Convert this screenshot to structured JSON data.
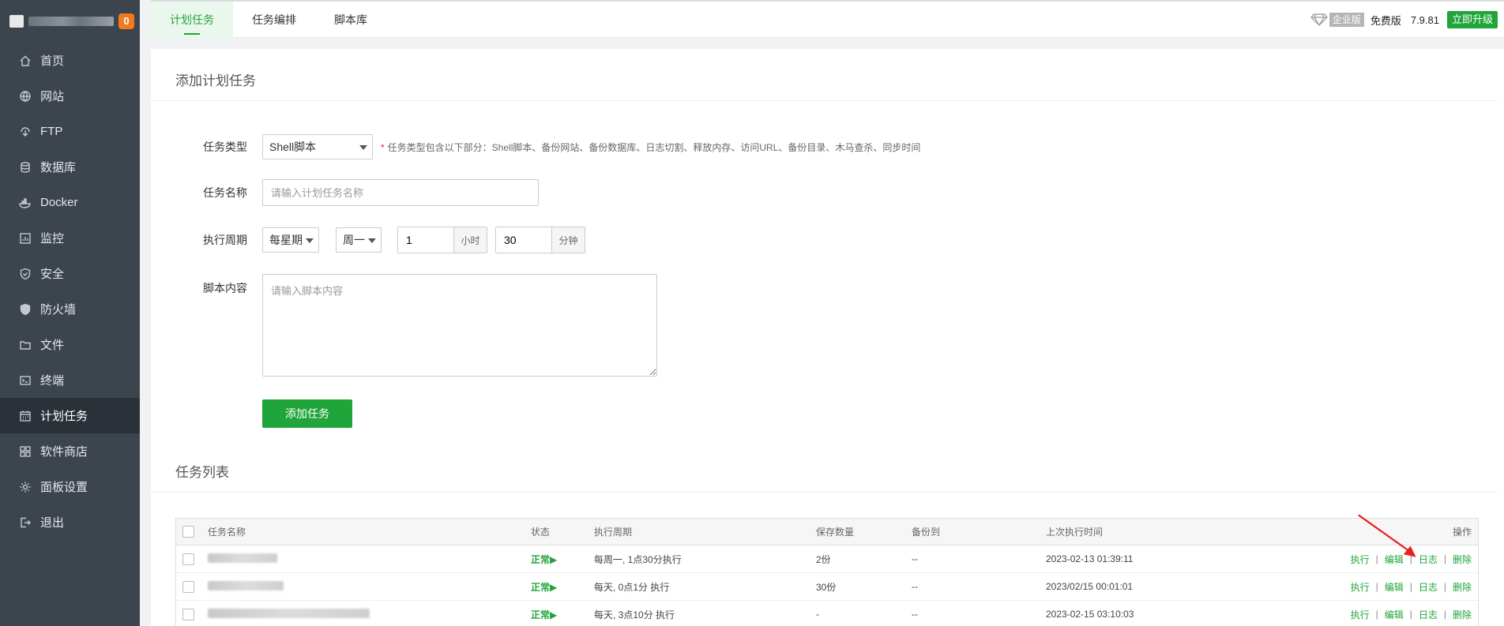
{
  "sidebar": {
    "badge": "0",
    "items": [
      {
        "label": "首页",
        "icon": "home-icon"
      },
      {
        "label": "网站",
        "icon": "globe-icon"
      },
      {
        "label": "FTP",
        "icon": "ftp-icon"
      },
      {
        "label": "数据库",
        "icon": "database-icon"
      },
      {
        "label": "Docker",
        "icon": "docker-icon"
      },
      {
        "label": "监控",
        "icon": "monitor-icon"
      },
      {
        "label": "安全",
        "icon": "shield-icon"
      },
      {
        "label": "防火墙",
        "icon": "firewall-icon"
      },
      {
        "label": "文件",
        "icon": "folder-icon"
      },
      {
        "label": "终端",
        "icon": "terminal-icon"
      },
      {
        "label": "计划任务",
        "icon": "calendar-icon",
        "active": true
      },
      {
        "label": "软件商店",
        "icon": "apps-icon"
      },
      {
        "label": "面板设置",
        "icon": "settings-icon"
      },
      {
        "label": "退出",
        "icon": "logout-icon"
      }
    ]
  },
  "topnav": {
    "tabs": [
      "计划任务",
      "任务编排",
      "脚本库"
    ],
    "enterprise": "企业版",
    "free": "免费版",
    "version": "7.9.81",
    "upgrade": "立即升级"
  },
  "form": {
    "title": "添加计划任务",
    "type_label": "任务类型",
    "type_value": "Shell脚本",
    "type_hint": "任务类型包含以下部分：Shell脚本、备份网站、备份数据库、日志切割、释放内存、访问URL、备份目录、木马查杀、同步时间",
    "name_label": "任务名称",
    "name_placeholder": "请输入计划任务名称",
    "period_label": "执行周期",
    "period_type": "每星期",
    "weekday": "周一",
    "hour_value": "1",
    "hour_unit": "小时",
    "minute_value": "30",
    "minute_unit": "分钟",
    "script_label": "脚本内容",
    "script_placeholder": "请输入脚本内容",
    "submit": "添加任务"
  },
  "list": {
    "title": "任务列表",
    "headers": {
      "name": "任务名称",
      "status": "状态",
      "period": "执行周期",
      "keep": "保存数量",
      "backup": "备份到",
      "last_run": "上次执行时间",
      "ops": "操作"
    },
    "ops": [
      "执行",
      "编辑",
      "日志",
      "删除"
    ],
    "rows": [
      {
        "status": "正常▶",
        "period": "每周一, 1点30分执行",
        "keep": "2份",
        "backup": "--",
        "last_run": "2023-02-13 01:39:11"
      },
      {
        "status": "正常▶",
        "period": "每天, 0点1分 执行",
        "keep": "30份",
        "backup": "--",
        "last_run": "2023/02/15 00:01:01"
      },
      {
        "status": "正常▶",
        "period": "每天, 3点10分 执行",
        "keep": "-",
        "backup": "--",
        "last_run": "2023-02-15 03:10:03"
      }
    ]
  },
  "colors": {
    "accent": "#20a53a",
    "sidebar": "#3c444d",
    "badge": "#f07a20",
    "arrow": "#e8231f"
  }
}
